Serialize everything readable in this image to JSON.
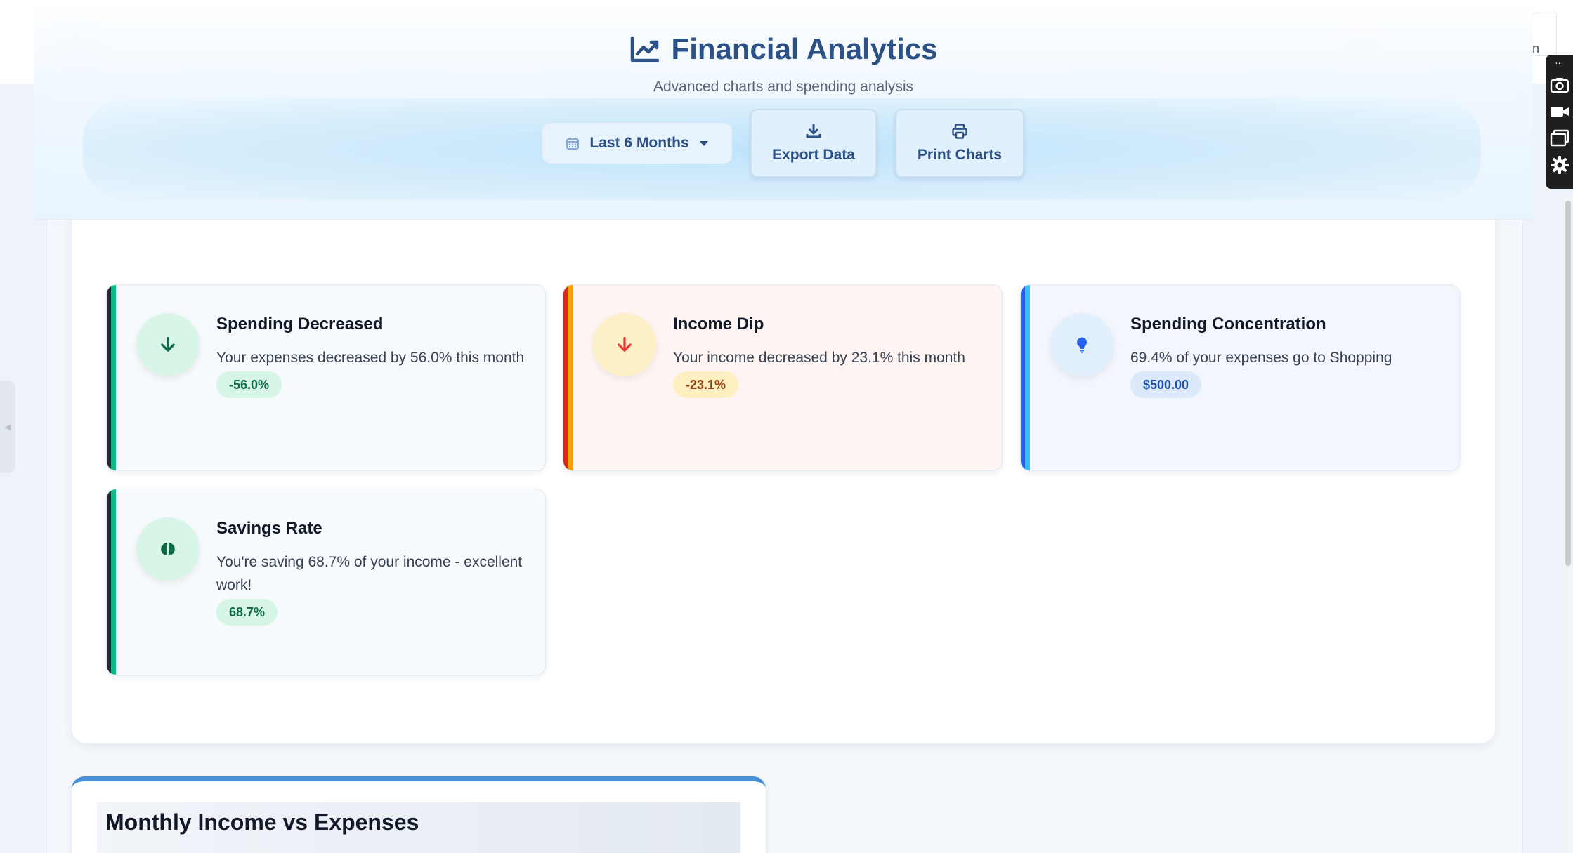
{
  "header": {
    "title": "Financial Analytics",
    "subtitle": "Advanced charts and spending analysis",
    "range_label": "Last 6 Months",
    "export_label": "Export Data",
    "print_label": "Print Charts"
  },
  "topnav": {
    "edge_button_text": "n"
  },
  "insights": [
    {
      "title": "Spending Decreased",
      "text": "Your expenses decreased by 56.0% this month",
      "badge": "-56.0%",
      "icon": "arrow-down-icon"
    },
    {
      "title": "Income Dip",
      "text": "Your income decreased by 23.1% this month",
      "badge": "-23.1%",
      "icon": "arrow-down-icon"
    },
    {
      "title": "Spending Concentration",
      "text": "69.4% of your expenses go to Shopping",
      "badge": "$500.00",
      "icon": "lightbulb-icon"
    },
    {
      "title": "Savings Rate",
      "text": "You're saving 68.7% of your income - excellent work!",
      "badge": "68.7%",
      "icon": "brain-icon"
    }
  ],
  "chart_section": {
    "title": "Monthly Income vs Expenses"
  },
  "colors": {
    "brand": "#2b5186",
    "success": "#10b981",
    "warning": "#f59e0b",
    "danger": "#dc2626",
    "info": "#2563eb"
  },
  "icons": {
    "title": "chart-line-icon",
    "range": "calendar-icon",
    "export": "download-icon",
    "print": "printer-icon"
  }
}
